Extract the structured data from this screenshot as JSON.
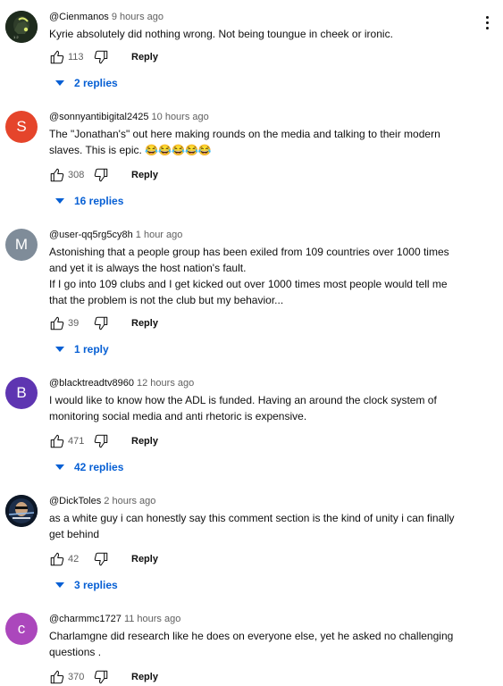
{
  "labels": {
    "reply": "Reply"
  },
  "comments": [
    {
      "author": "@Cienmanos",
      "time": "9 hours ago",
      "avatar": {
        "type": "image",
        "bg": "#1e2b1d",
        "accent": "#d9e86f"
      },
      "text": [
        "Kyrie absolutely did nothing wrong.  Not being toungue in cheek or ironic."
      ],
      "likes": "113",
      "replies": "2 replies"
    },
    {
      "author": "@sonnyantibigital2425",
      "time": "10 hours ago",
      "avatar": {
        "type": "letter",
        "letter": "S",
        "bg": "#e5452b"
      },
      "text": [
        "The \"Jonathan's\" out here making rounds on the media and talking to their modern",
        "slaves. This is epic. 😂😂😂😂😂"
      ],
      "likes": "308",
      "replies": "16 replies"
    },
    {
      "author": "@user-qq5rg5cy8h",
      "time": "1 hour ago",
      "avatar": {
        "type": "letter",
        "letter": "M",
        "bg": "#7f8c99"
      },
      "text": [
        "Astonishing that a people group has been exiled from 109 countries over 1000 times",
        "and yet it is always the host nation's fault.",
        "If I go into 109 clubs and I get kicked out over 1000 times most people would tell me",
        "that the problem is not the club but my behavior..."
      ],
      "likes": "39",
      "replies": "1 reply"
    },
    {
      "author": "@blacktreadtv8960",
      "time": "12 hours ago",
      "avatar": {
        "type": "letter",
        "letter": "B",
        "bg": "#5e35b1"
      },
      "text": [
        "I would like to know how the ADL is funded. Having an around the clock system of",
        "monitoring social media and anti rhetoric is expensive."
      ],
      "likes": "471",
      "replies": "42 replies"
    },
    {
      "author": "@DickToles",
      "time": "2 hours ago",
      "avatar": {
        "type": "image",
        "bg": "#0d1726",
        "accent": "#c9a27e"
      },
      "text": [
        "as a white guy i can honestly say this comment section is the kind of unity i can finally",
        "get behind"
      ],
      "likes": "42",
      "replies": "3 replies"
    },
    {
      "author": "@charmmc1727",
      "time": "11 hours ago",
      "avatar": {
        "type": "letter",
        "letter": "c",
        "bg": "#ab47bc"
      },
      "text": [
        "Charlamgne  did research like he does on everyone else, yet he asked no challenging",
        "questions ."
      ],
      "likes": "370",
      "replies": ""
    }
  ]
}
